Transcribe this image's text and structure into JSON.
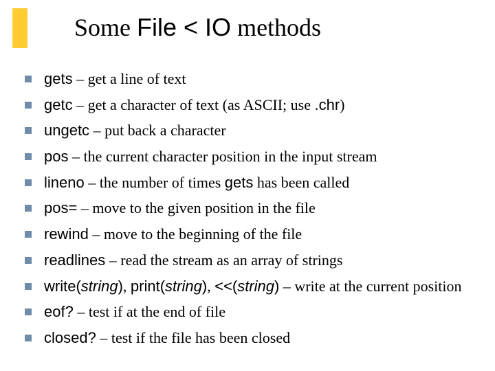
{
  "title": {
    "pre": "Some ",
    "code": "File < IO",
    "post": " methods"
  },
  "items": [
    {
      "segments": [
        {
          "t": "gets",
          "cls": "code"
        },
        {
          "t": " – get a line of text"
        }
      ]
    },
    {
      "segments": [
        {
          "t": "getc",
          "cls": "code"
        },
        {
          "t": " – get a character of text (as ASCII; use "
        },
        {
          "t": ".chr",
          "cls": "code"
        },
        {
          "t": ")"
        }
      ]
    },
    {
      "segments": [
        {
          "t": "ungetc",
          "cls": "code"
        },
        {
          "t": " – put back a character"
        }
      ]
    },
    {
      "segments": [
        {
          "t": "pos",
          "cls": "code"
        },
        {
          "t": " – the current character position in the input stream"
        }
      ]
    },
    {
      "segments": [
        {
          "t": "lineno",
          "cls": "code"
        },
        {
          "t": " – the number of times "
        },
        {
          "t": "gets",
          "cls": "code"
        },
        {
          "t": " has been called"
        }
      ]
    },
    {
      "segments": [
        {
          "t": "pos=",
          "cls": "code"
        },
        {
          "t": " – move to the given position in the file"
        }
      ]
    },
    {
      "segments": [
        {
          "t": "rewind",
          "cls": "code"
        },
        {
          "t": " – move to the beginning of the file"
        }
      ]
    },
    {
      "segments": [
        {
          "t": "readlines",
          "cls": "code"
        },
        {
          "t": " – read the stream as an array of strings"
        }
      ]
    },
    {
      "segments": [
        {
          "t": "write(",
          "cls": "code"
        },
        {
          "t": "string",
          "cls": "code ital"
        },
        {
          "t": ")",
          "cls": "code"
        },
        {
          "t": ", "
        },
        {
          "t": "print(",
          "cls": "code"
        },
        {
          "t": "string",
          "cls": "code ital"
        },
        {
          "t": ")",
          "cls": "code"
        },
        {
          "t": ", "
        },
        {
          "t": "<<(",
          "cls": "code"
        },
        {
          "t": "string",
          "cls": "code ital"
        },
        {
          "t": ")",
          "cls": "code"
        },
        {
          "t": " – write at the current position"
        }
      ]
    },
    {
      "segments": [
        {
          "t": "eof?",
          "cls": "code"
        },
        {
          "t": " – test if at the end of file"
        }
      ]
    },
    {
      "segments": [
        {
          "t": "closed?",
          "cls": "code"
        },
        {
          "t": " – test if the file has been closed"
        }
      ]
    }
  ]
}
